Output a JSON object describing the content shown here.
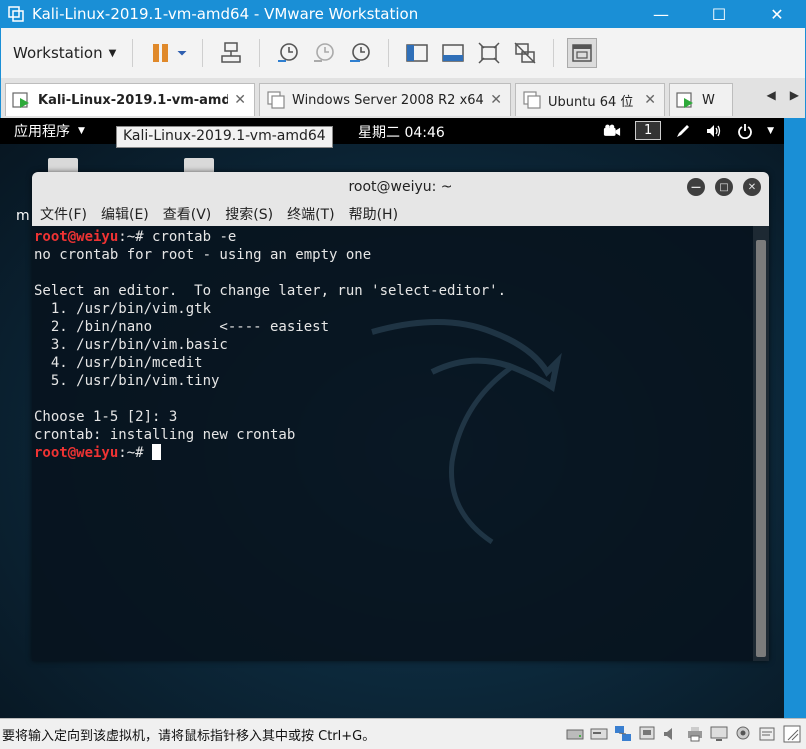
{
  "window": {
    "title": "Kali-Linux-2019.1-vm-amd64 - VMware Workstation",
    "minimize": "—",
    "maximize": "☐",
    "close": "✕"
  },
  "toolbar": {
    "workstation_menu": "Workstation",
    "caret": "▼"
  },
  "tabs": [
    {
      "label": "Kali-Linux-2019.1-vm-amd64",
      "close": "✕"
    },
    {
      "label": "Windows Server 2008 R2 x64",
      "close": "✕"
    },
    {
      "label": "Ubuntu 64 位",
      "close": "✕"
    },
    {
      "label": "W",
      "close": ""
    }
  ],
  "tab_arrows": {
    "left": "◀",
    "right": "▶"
  },
  "guest": {
    "apps_menu": "应用程序",
    "caret": "▼",
    "tooltip": "Kali-Linux-2019.1-vm-amd64",
    "clock": "星期二 04:46",
    "workspace": "1",
    "desktop_letter": "m"
  },
  "terminal": {
    "title": "root@weiyu: ~",
    "menu": [
      "文件(F)",
      "编辑(E)",
      "查看(V)",
      "搜索(S)",
      "终端(T)",
      "帮助(H)"
    ],
    "prompt_user": "root@weiyu",
    "prompt_tail": ":~# ",
    "line1_cmd": "crontab -e",
    "line2": "no crontab for root - using an empty one",
    "line3": "",
    "line4": "Select an editor.  To change later, run 'select-editor'.",
    "line5": "  1. /usr/bin/vim.gtk",
    "line6": "  2. /bin/nano        <---- easiest",
    "line7": "  3. /usr/bin/vim.basic",
    "line8": "  4. /usr/bin/mcedit",
    "line9": "  5. /usr/bin/vim.tiny",
    "line10": "",
    "line11": "Choose 1-5 [2]: 3",
    "line12": "crontab: installing new crontab"
  },
  "statusbar": {
    "text": "要将输入定向到该虚拟机，请将鼠标指针移入其中或按 Ctrl+G。"
  }
}
